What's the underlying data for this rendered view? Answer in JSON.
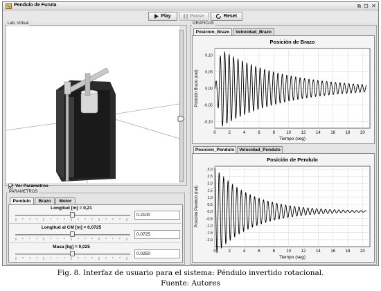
{
  "window": {
    "title": "Pendulo de Furuta",
    "controls": [
      "⧉",
      "⊡",
      "✕"
    ]
  },
  "toolbar": {
    "play": "Play",
    "pause": "Pause",
    "reset": "Reset"
  },
  "left": {
    "group_title": "Lab. Virtual",
    "show_params_label": "Ver Parámetros",
    "params_title": "PARAMETROS",
    "tabs": [
      "Pendulo",
      "Brazo",
      "Motor"
    ],
    "params": [
      {
        "label": "Longitud [m] = 0,21",
        "value": "0.2100",
        "level": 0.5
      },
      {
        "label": "Longitud al CM [m] = 0,0725",
        "value": "0.0725",
        "level": 0.5
      },
      {
        "label": "Masa [kg] = 0,025",
        "value": "0.0250",
        "level": 0.5
      }
    ]
  },
  "right": {
    "group_title": "GRAFICAS",
    "top_tabs": [
      "Posicion_Brazo",
      "Velocidad_Brazo"
    ],
    "bottom_tabs": [
      "Posicion_Pendulo",
      "Velocidad_Pendulo"
    ]
  },
  "caption": {
    "line1": "Fig. 8. Interfaz de usuario para el sistema: Péndulo invertido rotacional.",
    "line2": "Fuente: Autores"
  },
  "chart_data": [
    {
      "type": "line",
      "title": "Posición de Brazo",
      "xlabel": "Tiempo (seg)",
      "ylabel": "Posición Brazo (rad)",
      "xlim": [
        0,
        21
      ],
      "ylim": [
        -0.12,
        0.12
      ],
      "xticks": [
        0,
        2,
        4,
        6,
        8,
        10,
        12,
        14,
        16,
        18,
        20
      ],
      "yticks": [
        -0.1,
        -0.05,
        0.0,
        0.05,
        0.1
      ],
      "ytick_labels": [
        "-0,10",
        "-0,05",
        "0,00",
        "0,05",
        "0,10"
      ],
      "grid": true,
      "series": [
        {
          "amplitude": 0.115,
          "period": 0.6,
          "decay": 0.12,
          "start": 0.0,
          "end": 0.0
        }
      ]
    },
    {
      "type": "line",
      "title": "Posición de Pendulo",
      "xlabel": "Tiempo (seg)",
      "ylabel": "Posición Pendulo (rad)",
      "xlim": [
        0,
        21
      ],
      "ylim": [
        -2.5,
        3.2
      ],
      "xticks": [
        0,
        2,
        4,
        6,
        8,
        10,
        12,
        14,
        16,
        18,
        20
      ],
      "yticks": [
        3.0,
        2.5,
        2.0,
        1.5,
        1.0,
        0.5,
        0.0,
        -0.5,
        -1.0,
        -1.5,
        -2.0
      ],
      "ytick_labels": [
        "3,0",
        "2,5",
        "2,0",
        "1,5",
        "1,0",
        "0,5",
        "0,0",
        "-0,5",
        "-1,0",
        "-1,5",
        "-2,0"
      ],
      "grid": true,
      "series": [
        {
          "amplitude": 3.1,
          "period": 0.6,
          "decay": 0.2,
          "start": 3.1,
          "end": 0.0
        }
      ]
    }
  ]
}
